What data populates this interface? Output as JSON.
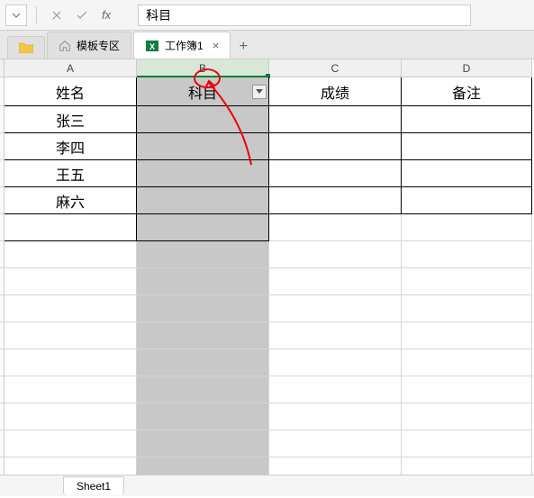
{
  "formula_bar": {
    "value": "科目"
  },
  "file_tabs": {
    "template_tab": "模板专区",
    "workbook_tab": "工作簿1"
  },
  "columns": {
    "a": "A",
    "b": "B",
    "c": "C",
    "d": "D"
  },
  "headers": {
    "name": "姓名",
    "subject": "科目",
    "score": "成绩",
    "remark": "备注"
  },
  "data": {
    "r1": "张三",
    "r2": "李四",
    "r3": "王五",
    "r4": "麻六"
  },
  "sheet": {
    "name": "Sheet1"
  }
}
